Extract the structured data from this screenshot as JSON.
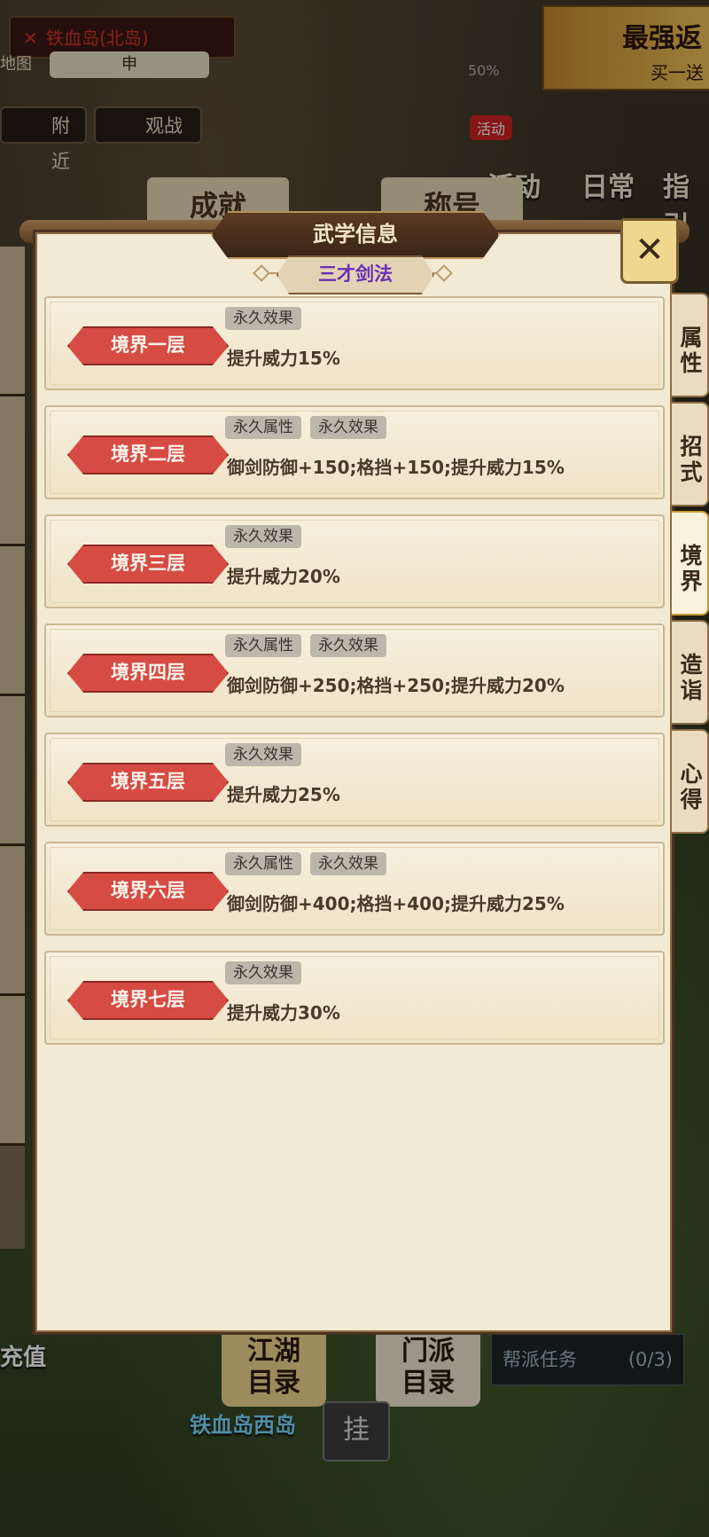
{
  "hud": {
    "location": "铁血岛(北岛)",
    "map_label": "地图",
    "shen_label": "申",
    "nearby_label": "附近",
    "spectate_label": "观战",
    "upgrade_pct": "50%",
    "banner_title": "最强返",
    "banner_sub": "买一送",
    "activity_tag": "活动",
    "activity_label": "活动",
    "daily_label": "日常",
    "guide_label": "指引"
  },
  "background_tabs": [
    "成就",
    "称号"
  ],
  "dialog": {
    "title": "武学信息",
    "close_icon": "crossed-swords-close-icon",
    "skill_name": "三才剑法",
    "realms": [
      {
        "name": "境界一层",
        "tags": [
          "永久效果"
        ],
        "effect": "提升威力15%"
      },
      {
        "name": "境界二层",
        "tags": [
          "永久属性",
          "永久效果"
        ],
        "effect": "御剑防御+150;格挡+150;提升威力15%"
      },
      {
        "name": "境界三层",
        "tags": [
          "永久效果"
        ],
        "effect": "提升威力20%"
      },
      {
        "name": "境界四层",
        "tags": [
          "永久属性",
          "永久效果"
        ],
        "effect": "御剑防御+250;格挡+250;提升威力20%"
      },
      {
        "name": "境界五层",
        "tags": [
          "永久效果"
        ],
        "effect": "提升威力25%"
      },
      {
        "name": "境界六层",
        "tags": [
          "永久属性",
          "永久效果"
        ],
        "effect": "御剑防御+400;格挡+400;提升威力25%"
      },
      {
        "name": "境界七层",
        "tags": [
          "永久效果"
        ],
        "effect": "提升威力30%"
      }
    ],
    "side_tabs": [
      {
        "label": "属性",
        "active": false
      },
      {
        "label": "招式",
        "active": false
      },
      {
        "label": "境界",
        "active": true
      },
      {
        "label": "造诣",
        "active": false
      },
      {
        "label": "心得",
        "active": false
      }
    ]
  },
  "bottom": {
    "recharge_label": "充值",
    "jianghu_dir": [
      "江湖",
      "目录"
    ],
    "sect_dir": [
      "门派",
      "目录"
    ],
    "west_island": "铁血岛西岛",
    "gua_label": "挂",
    "gang_task": "帮派任务",
    "gang_task_count": "(0/3)"
  }
}
